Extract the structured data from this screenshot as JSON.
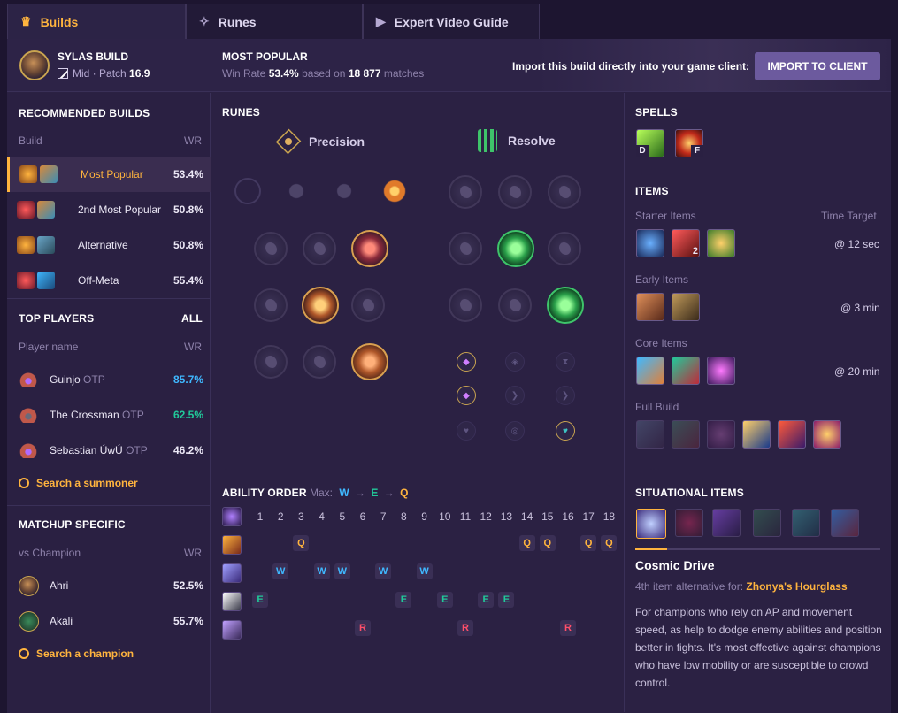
{
  "tabs": [
    {
      "label": "Builds",
      "icon": "crown-icon"
    },
    {
      "label": "Runes",
      "icon": "rune-icon"
    },
    {
      "label": "Expert Video Guide",
      "icon": "video-icon"
    }
  ],
  "champion": {
    "build_label": "SYLAS BUILD",
    "role": "Mid",
    "patch_label": "Patch",
    "patch": "16.9"
  },
  "popular": {
    "title": "MOST POPULAR",
    "winrate_label": "Win Rate",
    "winrate": "53.4%",
    "based_on": "based on",
    "matches": "18 877",
    "matches_label": "matches"
  },
  "import": {
    "text": "Import this build directly into your game client:",
    "button": "IMPORT TO CLIENT"
  },
  "recommended": {
    "title": "RECOMMENDED BUILDS",
    "col_build": "Build",
    "col_wr": "WR",
    "rows": [
      {
        "name": "Most Popular",
        "wr": "53.4%"
      },
      {
        "name": "2nd Most Popular",
        "wr": "50.8%"
      },
      {
        "name": "Alternative",
        "wr": "50.8%"
      },
      {
        "name": "Off-Meta",
        "wr": "55.4%"
      }
    ]
  },
  "top_players": {
    "title": "TOP PLAYERS",
    "all": "ALL",
    "col_name": "Player name",
    "col_wr": "WR",
    "rows": [
      {
        "name": "Guinjo",
        "tag": "OTP",
        "wr": "85.7%",
        "color": "#3fb8ff"
      },
      {
        "name": "The Crossman",
        "tag": "OTP",
        "wr": "62.5%",
        "color": "#21c99a"
      },
      {
        "name": "Sebastian ÚwÚ",
        "tag": "OTP",
        "wr": "46.2%",
        "color": "#ece8f6"
      }
    ],
    "search": "Search a summoner"
  },
  "matchup": {
    "title": "MATCHUP SPECIFIC",
    "vs": "vs Champion",
    "col_wr": "WR",
    "rows": [
      {
        "name": "Ahri",
        "wr": "52.5%"
      },
      {
        "name": "Akali",
        "wr": "55.7%"
      }
    ],
    "search": "Search a champion"
  },
  "runes": {
    "title": "RUNES",
    "primary": "Precision",
    "secondary": "Resolve"
  },
  "ability": {
    "title": "ABILITY ORDER",
    "max_label": "Max:",
    "max": [
      "W",
      "E",
      "Q"
    ],
    "arrow": "→",
    "levels": [
      "1",
      "2",
      "3",
      "4",
      "5",
      "6",
      "7",
      "8",
      "9",
      "10",
      "11",
      "12",
      "13",
      "14",
      "15",
      "16",
      "17",
      "18"
    ],
    "order": [
      "E",
      "W",
      "Q",
      "W",
      "W",
      "R",
      "W",
      "E",
      "W",
      "E",
      "R",
      "E",
      "E",
      "Q",
      "Q",
      "R",
      "Q",
      "Q"
    ]
  },
  "spells": {
    "title": "SPELLS",
    "d": "D",
    "f": "F"
  },
  "items": {
    "title": "ITEMS",
    "starter": {
      "label": "Starter Items",
      "time_label": "Time Target",
      "time": "@ 12 sec",
      "count": "2"
    },
    "early": {
      "label": "Early Items",
      "time": "@ 3 min"
    },
    "core": {
      "label": "Core Items",
      "time": "@ 20 min"
    },
    "full": {
      "label": "Full Build"
    }
  },
  "situational": {
    "title": "SITUATIONAL ITEMS",
    "item_name": "Cosmic Drive",
    "alt_prefix": "4th item alternative for:",
    "alt_item": "Zhonya's Hourglass",
    "desc": "For champions who rely on AP and movement speed, as help to dodge enemy abilities and position better in fights. It's most effective against champions who have low mobility or are susceptible to crowd control."
  },
  "colors": {
    "accent": "#ffb43e",
    "q": "#ffb43e",
    "w": "#3fb8ff",
    "e": "#21c99a",
    "r": "#ff4f6a",
    "button": "#6c5a9e"
  }
}
